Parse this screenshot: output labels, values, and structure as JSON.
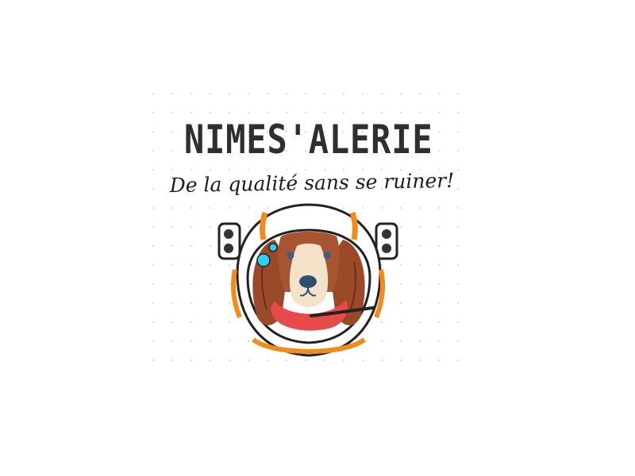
{
  "logo": {
    "title": "NIMES'ALERIE",
    "tagline": "De la qualité sans se ruiner!"
  },
  "colors": {
    "text": "#2f2f2f",
    "helmet_orange": "#f28a1c",
    "visor_blue": "#2fd0f0",
    "dog_brown": "#9a4a28",
    "dog_cream": "#f4e3c8",
    "scarf_red": "#e84a4a"
  },
  "icons": {
    "mascot": "astronaut-dog-icon"
  }
}
